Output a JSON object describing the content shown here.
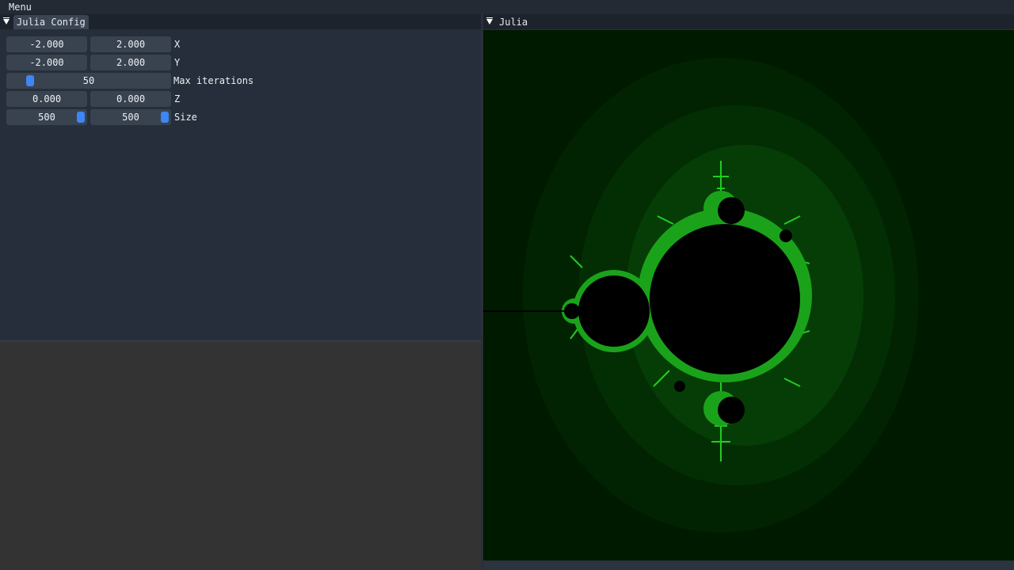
{
  "menubar": {
    "menu_label": "Menu"
  },
  "config": {
    "title": "Julia Config",
    "x": {
      "min": "-2.000",
      "max": "2.000",
      "label": "X"
    },
    "y": {
      "min": "-2.000",
      "max": "2.000",
      "label": "Y"
    },
    "max_iterations": {
      "value": "50",
      "label": "Max iterations"
    },
    "z": {
      "re": "0.000",
      "im": "0.000",
      "label": "Z"
    },
    "size": {
      "width": "500",
      "height": "500",
      "label": "Size"
    }
  },
  "julia": {
    "title": "Julia",
    "colors": {
      "background": "#001a00",
      "set": "#000000",
      "edge": "#22cc22"
    }
  }
}
